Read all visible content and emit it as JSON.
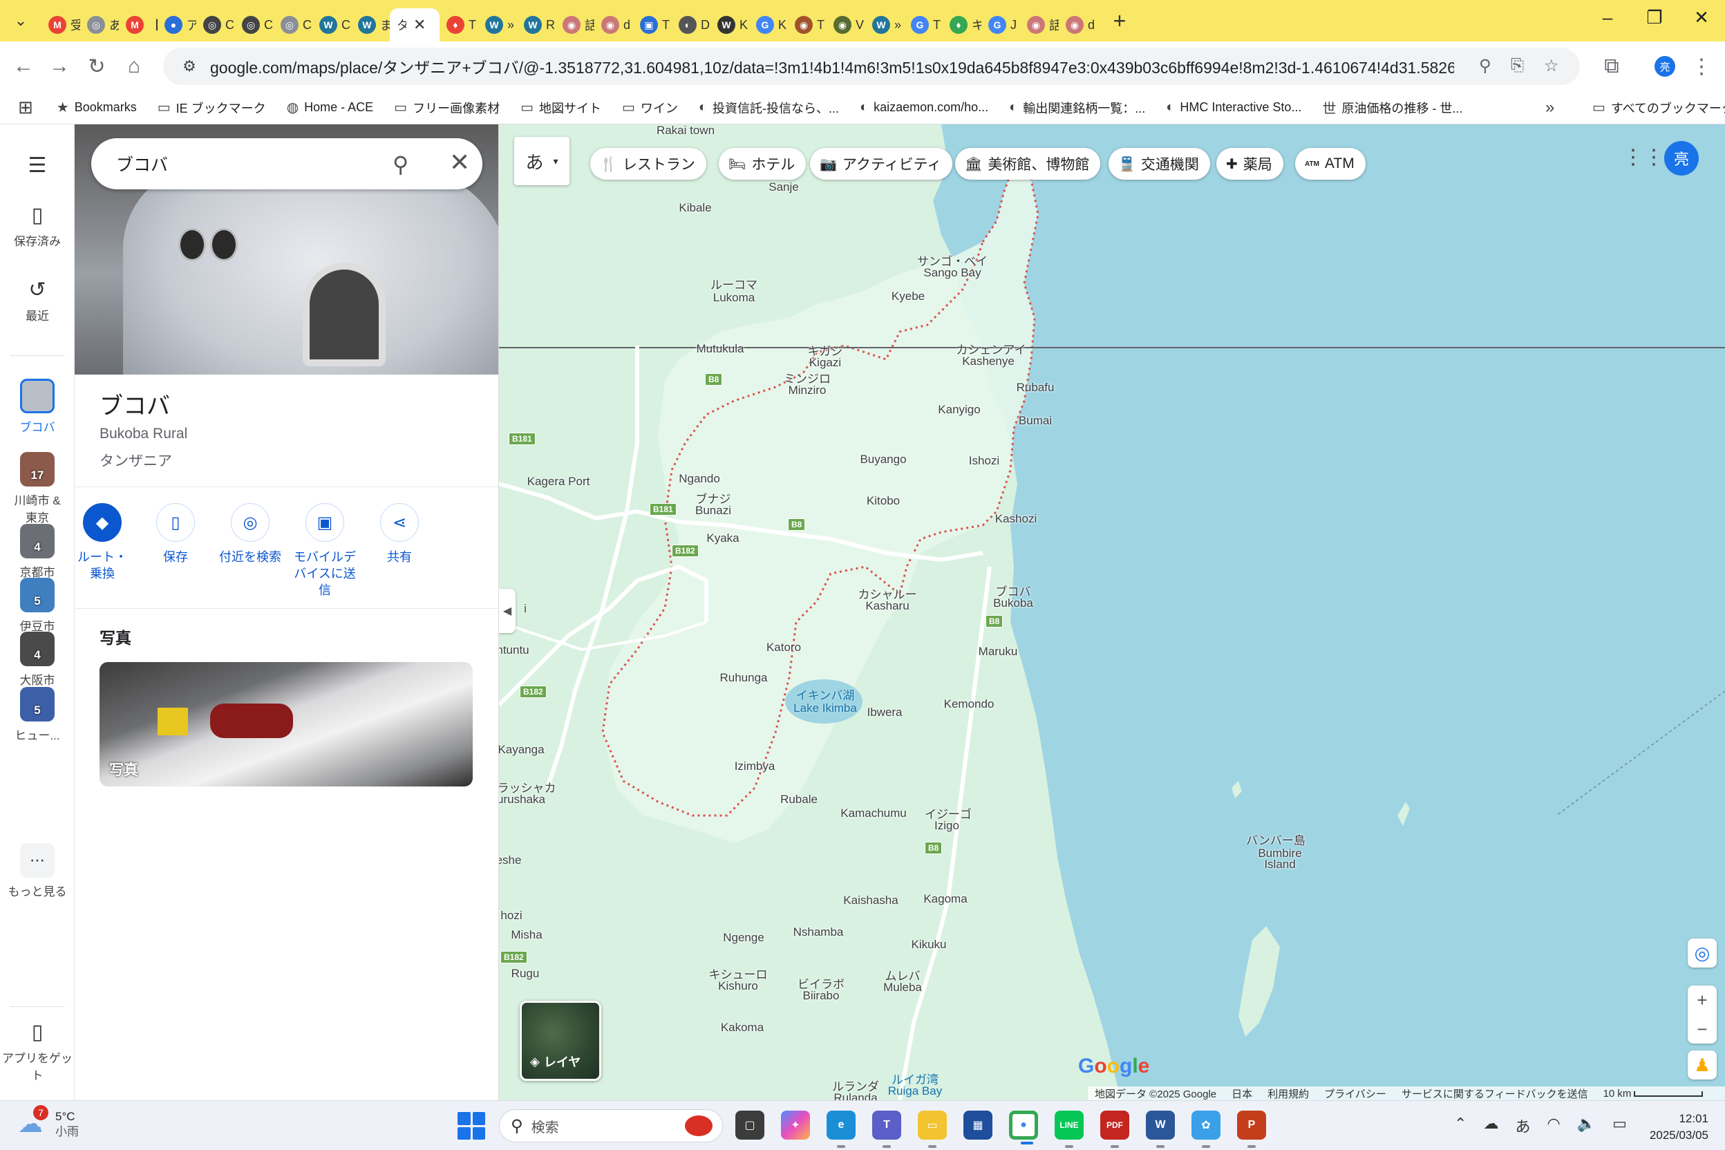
{
  "browser": {
    "tabs": [
      {
        "title": "受",
        "icon": "M",
        "color": "#ea4335",
        "icon_name": "gmail-icon"
      },
      {
        "title": "あ",
        "icon": "◎",
        "color": "#8a8f96",
        "icon_name": "chatgpt-icon"
      },
      {
        "title": "【",
        "icon": "M",
        "color": "#ea4335",
        "icon_name": "gmail-icon"
      },
      {
        "title": "ア",
        "icon": "●",
        "color": "#2a6fd6",
        "icon_name": "site-icon"
      },
      {
        "title": "C",
        "icon": "◎",
        "color": "#444444",
        "icon_name": "chatgpt-icon"
      },
      {
        "title": "C",
        "icon": "◎",
        "color": "#444444",
        "icon_name": "chatgpt-icon"
      },
      {
        "title": "C",
        "icon": "◎",
        "color": "#8a8f96",
        "icon_name": "chatgpt-icon"
      },
      {
        "title": "C",
        "icon": "W",
        "color": "#21759b",
        "icon_name": "wordpress-icon"
      },
      {
        "title": "ま",
        "icon": "W",
        "color": "#21759b",
        "icon_name": "wordpress-icon"
      },
      {
        "title": "タ",
        "icon": "",
        "color": "",
        "icon_name": "maps-tab-icon"
      },
      {
        "title": "T",
        "icon": "♦",
        "color": "#ea4335",
        "icon_name": "pin-icon"
      },
      {
        "title": "»",
        "icon": "W",
        "color": "#21759b",
        "icon_name": "wordpress-icon"
      },
      {
        "title": "R",
        "icon": "W",
        "color": "#21759b",
        "icon_name": "wordpress-icon"
      },
      {
        "title": "話",
        "icon": "◉",
        "color": "#c77",
        "icon_name": "site-icon"
      },
      {
        "title": "d",
        "icon": "◉",
        "color": "#c77",
        "icon_name": "site-icon"
      },
      {
        "title": "T",
        "icon": "▣",
        "color": "#2a6fd6",
        "icon_name": "site-icon"
      },
      {
        "title": "D",
        "icon": "◐",
        "color": "#555555",
        "icon_name": "site-icon"
      },
      {
        "title": "K",
        "icon": "W",
        "color": "#333333",
        "icon_name": "wikipedia-icon"
      },
      {
        "title": "K",
        "icon": "G",
        "color": "#4285f4",
        "icon_name": "google-icon"
      },
      {
        "title": "T",
        "icon": "◉",
        "color": "#a0522d",
        "icon_name": "site-icon"
      },
      {
        "title": "V",
        "icon": "◉",
        "color": "#556b2f",
        "icon_name": "site-icon"
      },
      {
        "title": "»",
        "icon": "W",
        "color": "#21759b",
        "icon_name": "wordpress-icon"
      },
      {
        "title": "T",
        "icon": "G",
        "color": "#4285f4",
        "icon_name": "google-icon"
      },
      {
        "title": "キ",
        "icon": "♦",
        "color": "#34a853",
        "icon_name": "maps-icon"
      },
      {
        "title": "J",
        "icon": "G",
        "color": "#4285f4",
        "icon_name": "google-icon"
      },
      {
        "title": "話",
        "icon": "◉",
        "color": "#c77",
        "icon_name": "site-icon"
      },
      {
        "title": "d",
        "icon": "◉",
        "color": "#c77",
        "icon_name": "site-icon"
      }
    ],
    "active_tab_label": "タ",
    "url": "google.com/maps/place/タンザニア+ブコバ/@-1.3518772,31.604981,10z/data=!3m1!4b1!4m6!3m5!1s0x19da645b8f8947e3:0x439b03c6bff6994e!8m2!3d-1.4610674!4d31.5826642!16s%2Fg%2F11c3xc...",
    "profile_initial": "亮",
    "bookmarks": [
      {
        "label": "Bookmarks",
        "icon": "★",
        "icon_name": "star-icon"
      },
      {
        "label": "IE ブックマーク",
        "icon": "▭",
        "icon_name": "folder-icon"
      },
      {
        "label": "Home - ACE",
        "icon": "◍",
        "icon_name": "site-icon"
      },
      {
        "label": "フリー画像素材",
        "icon": "▭",
        "icon_name": "folder-icon"
      },
      {
        "label": "地図サイト",
        "icon": "▭",
        "icon_name": "folder-icon"
      },
      {
        "label": "ワイン",
        "icon": "▭",
        "icon_name": "folder-icon"
      },
      {
        "label": "投資信託-投信なら、...",
        "icon": "◐",
        "icon_name": "site-icon"
      },
      {
        "label": "kaizaemon.com/ho...",
        "icon": "◐",
        "icon_name": "globe-icon"
      },
      {
        "label": "輸出関連銘柄一覧：...",
        "icon": "◐",
        "icon_name": "site-icon"
      },
      {
        "label": "HMC Interactive Sto...",
        "icon": "◐",
        "icon_name": "site-icon"
      },
      {
        "label": "原油価格の推移 - 世...",
        "icon": "世",
        "icon_name": "site-icon"
      }
    ],
    "all_bookmarks": "すべてのブックマーク"
  },
  "rail": {
    "saved": "保存済み",
    "recent": "最近",
    "current": "ブコバ",
    "history": [
      {
        "label": "川崎市 & 東京",
        "count": "17",
        "color": "#8b5a4a"
      },
      {
        "label": "京都市",
        "count": "4",
        "color": "#6b6e74"
      },
      {
        "label": "伊豆市",
        "count": "5",
        "color": "#3f7fbf"
      },
      {
        "label": "大阪市",
        "count": "4",
        "color": "#4a4a4a"
      },
      {
        "label": "ヒュー...",
        "count": "5",
        "color": "#3d5fa8"
      }
    ],
    "more": "もっと見る",
    "get_app": "アプリをゲット"
  },
  "panel": {
    "search_value": "ブコバ",
    "title": "ブコバ",
    "sub1": "Bukoba Rural",
    "sub2": "タンザニア",
    "actions": [
      {
        "label": "ルート・乗換",
        "icon": "◆",
        "name": "directions-button"
      },
      {
        "label": "保存",
        "icon": "▯",
        "name": "save-button"
      },
      {
        "label": "付近を検索",
        "icon": "◎",
        "name": "nearby-button"
      },
      {
        "label": "モバイルデバイスに送信",
        "icon": "▣",
        "name": "send-to-phone-button"
      },
      {
        "label": "共有",
        "icon": "⋖",
        "name": "share-button"
      }
    ],
    "photos_heading": "写真",
    "photo_label": "写真"
  },
  "map": {
    "ime": "あ",
    "chips": [
      {
        "label": "レストラン",
        "icon": "🍴",
        "icon_name": "restaurant-icon"
      },
      {
        "label": "ホテル",
        "icon": "🛏",
        "icon_name": "hotel-icon"
      },
      {
        "label": "アクティビティ",
        "icon": "📷",
        "icon_name": "camera-icon"
      },
      {
        "label": "美術館、博物館",
        "icon": "🏛",
        "icon_name": "museum-icon"
      },
      {
        "label": "交通機関",
        "icon": "🚆",
        "icon_name": "transit-icon"
      },
      {
        "label": "薬局",
        "icon": "✚",
        "icon_name": "pharmacy-icon"
      },
      {
        "label": "ATM",
        "icon": "ATM",
        "icon_name": "atm-icon"
      }
    ],
    "avatar": "亮",
    "layers_label": "レイヤ",
    "google": "Google",
    "footer": {
      "data": "地図データ ©2025 Google",
      "country": "日本",
      "terms": "利用規約",
      "privacy": "プライバシー",
      "feedback": "サービスに関するフィードバックを送信",
      "scale": "10 km"
    },
    "labels": {
      "rakai": "Rakai town",
      "sanje": "Sanje",
      "kibale": "Kibale",
      "sango_bay_ja": "サンゴ・ベイ",
      "sango_bay": "Sango Bay",
      "lukoma_ja": "ルーコマ",
      "lukoma": "Lukoma",
      "kyebe": "Kyebe",
      "mutukula": "Mutukula",
      "kigazi_ja": "キガジ",
      "kigazi": "Kigazi",
      "kashenye_ja": "カシェンアイ",
      "kashenye": "Kashenye",
      "minziro_ja": "ミンジロ",
      "minziro": "Minziro",
      "rubafu": "Rubafu",
      "kanyigo": "Kanyigo",
      "bumai": "Bumai",
      "buyango": "Buyango",
      "ishozi": "Ishozi",
      "kagera_port": "Kagera Port",
      "ngando": "Ngando",
      "bunazi_ja": "ブナジ",
      "bunazi": "Bunazi",
      "kitobo": "Kitobo",
      "kashozi": "Kashozi",
      "kyaka": "Kyaka",
      "kasharu_ja": "カシャルー",
      "kasharu": "Kasharu",
      "bukoba_ja": "ブコバ",
      "bukoba": "Bukoba",
      "katoro": "Katoro",
      "maruku": "Maruku",
      "ruhunga": "Ruhunga",
      "ikimba_ja": "イキンバ湖",
      "ikimba": "Lake Ikimba",
      "ibwera": "Ibwera",
      "kemondo": "Kemondo",
      "ntuntu": "ntuntu",
      "kayanga": "Kayanga",
      "izimbya": "Izimbya",
      "lashaka_ja": "ラッシャカ",
      "rurushaka": "urushaka",
      "rubale": "Rubale",
      "kamachumu": "Kamachumu",
      "izigo_ja": "イジーゴ",
      "izigo": "Izigo",
      "bumbire_ja": "バンバー島",
      "bumbire": "Bumbire",
      "island": "Island",
      "eshe": "eshe",
      "kaishasha": "Kaishasha",
      "kagoma": "Kagoma",
      "hozi": "hozi",
      "misha": "Misha",
      "nshamba": "Nshamba",
      "ngenge": "Ngenge",
      "kikuku": "Kikuku",
      "rugu": "Rugu",
      "kishuro_ja": "キシューロ",
      "kishuro": "Kishuro",
      "biirabo_ja": "ビイラボ",
      "biirabo": "Biirabo",
      "muleba_ja": "ムレバ",
      "muleba": "Muleba",
      "kakoma": "Kakoma",
      "rulanda_ja": "ルランダ",
      "rulanda": "Rulanda",
      "ruiga_ja": "ルイガ湾",
      "ruiga": "Ruiga Bay",
      "i_edge": "i"
    },
    "roads": {
      "b8": "B8",
      "b181": "B181",
      "b182": "B182"
    }
  },
  "taskbar": {
    "temp": "5°C",
    "condition": "小雨",
    "badge": "7",
    "search": "検索",
    "time": "12:01",
    "date": "2025/03/05",
    "ime": "あ"
  }
}
